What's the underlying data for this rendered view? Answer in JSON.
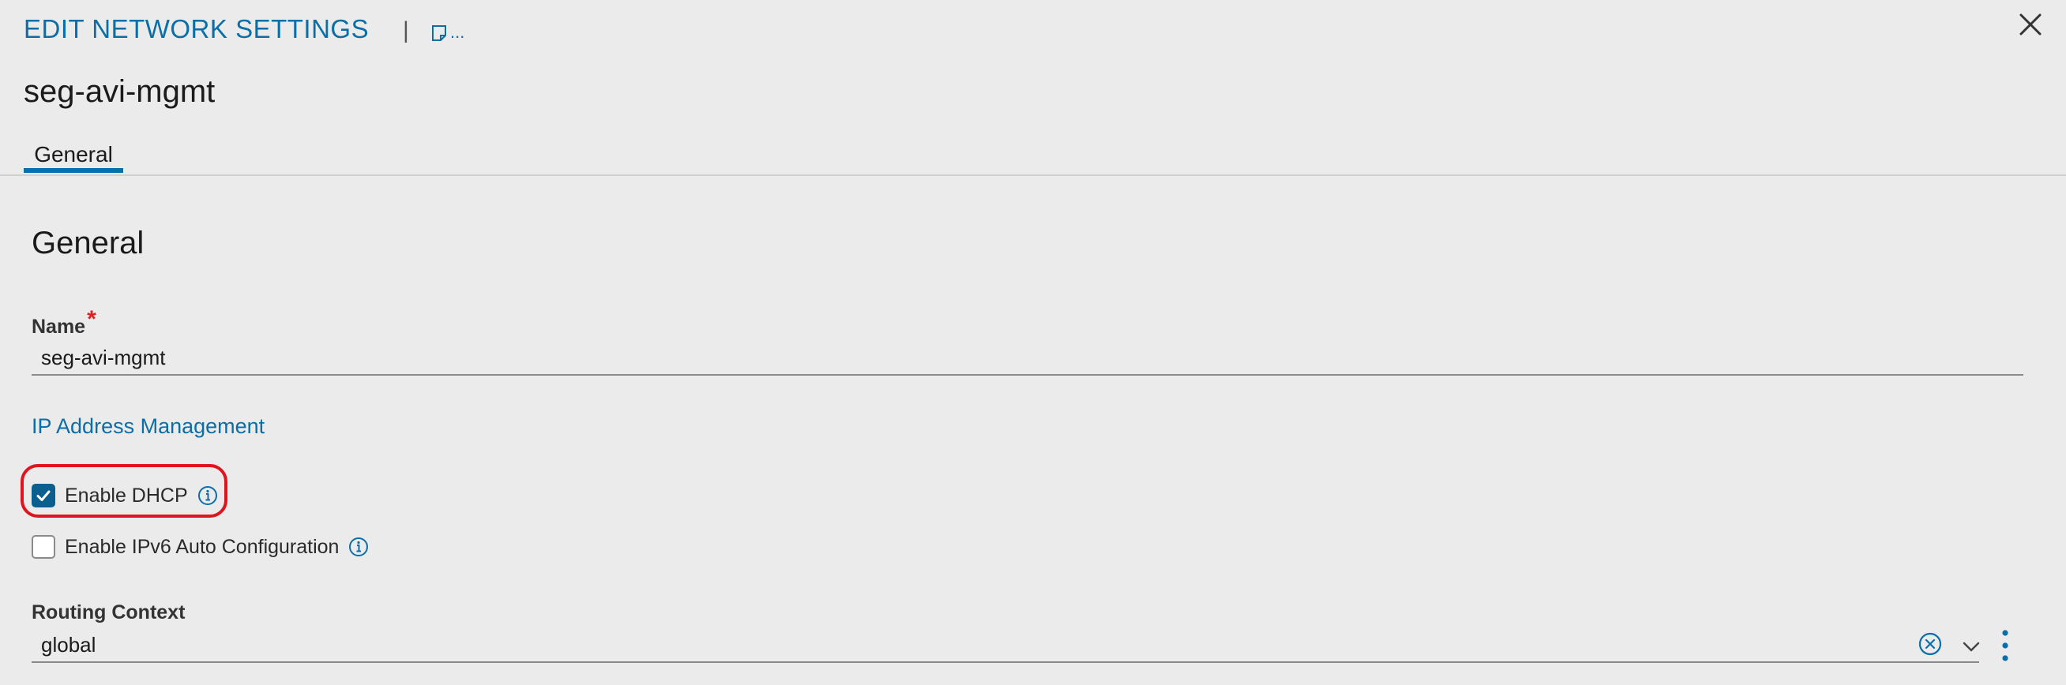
{
  "header": {
    "title": "EDIT NETWORK SETTINGS",
    "separator": "|",
    "note_ellipsis": "..."
  },
  "subtitle": "seg-avi-mgmt",
  "tabs": [
    {
      "label": "General",
      "active": true
    }
  ],
  "section": {
    "heading": "General"
  },
  "name_field": {
    "label": "Name",
    "required_marker": "*",
    "value": "seg-avi-mgmt"
  },
  "ip_management": {
    "heading": "IP Address Management",
    "enable_dhcp": {
      "label": "Enable DHCP",
      "checked": true
    },
    "enable_ipv6": {
      "label": "Enable IPv6 Auto Configuration",
      "checked": false
    }
  },
  "routing_context": {
    "label": "Routing Context",
    "value": "global"
  },
  "icons": {
    "close": "close-icon",
    "note": "note-icon",
    "info": "info-icon",
    "clear": "clear-circle-icon",
    "chevron": "chevron-down-icon",
    "kebab": "vertical-ellipsis-icon",
    "check": "checkmark-icon"
  },
  "colors": {
    "accent": "#0a6ea8",
    "checkbox_fill": "#0b5f8f",
    "required": "#e02020",
    "highlight": "#e0141e",
    "background": "#ebebeb"
  }
}
